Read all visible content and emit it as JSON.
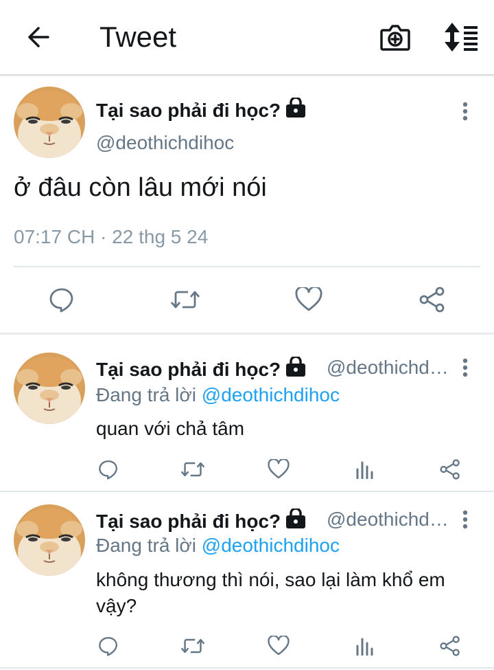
{
  "header": {
    "title": "Tweet",
    "back_icon": "arrow-left-icon",
    "camera_icon": "camera-plus-icon",
    "sort_icon": "sort-icon"
  },
  "main_tweet": {
    "display_name": "Tại sao phải đi học?",
    "handle": "@deothichdihoc",
    "text": "ở đâu còn lâu mới nói",
    "timestamp": "07:17 CH · 22 thg 5 24",
    "protected": true
  },
  "replies": [
    {
      "display_name": "Tại sao phải đi học?",
      "handle": "@deothichdihoc",
      "reply_prefix": "Đang trả lời ",
      "reply_to": "@deothichdihoc",
      "text": "quan với chả tâm"
    },
    {
      "display_name": "Tại sao phải đi học?",
      "handle": "@deothichdihoc",
      "reply_prefix": "Đang trả lời ",
      "reply_to": "@deothichdihoc",
      "text": "không thương thì nói, sao lại làm khổ em vậy?"
    }
  ],
  "colors": {
    "text": "#14171a",
    "secondary": "#657786",
    "link": "#1da1f2",
    "icon": "#657786"
  }
}
